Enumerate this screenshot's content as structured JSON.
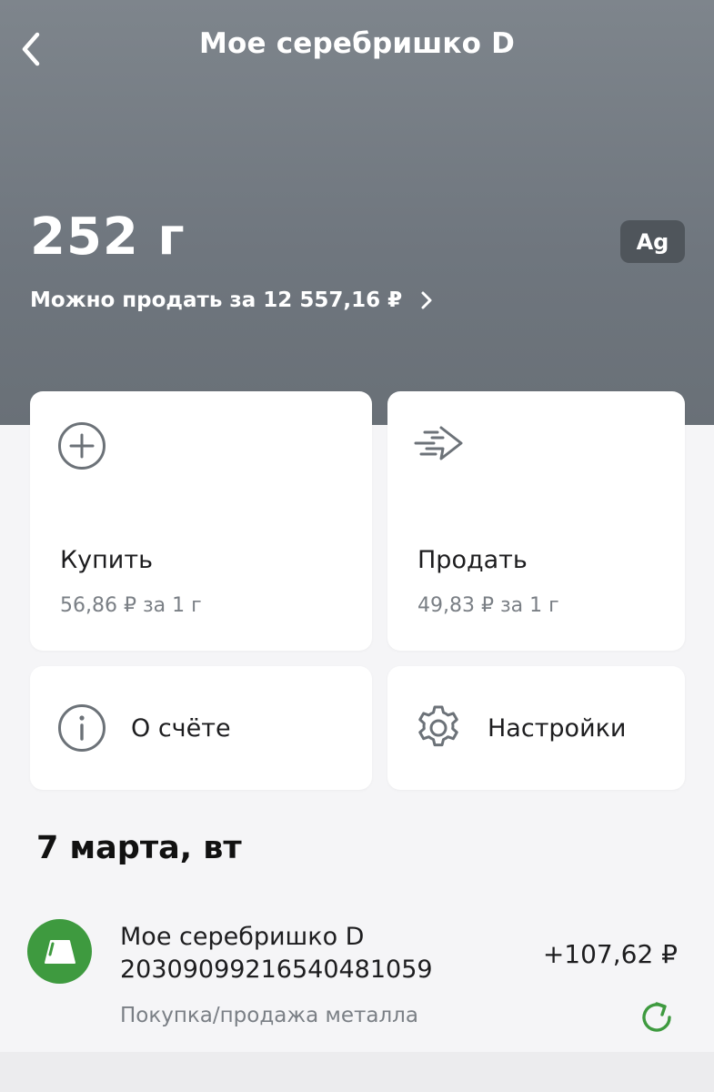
{
  "header": {
    "title": "Мое серебришко D",
    "back_icon": "chevron-left-icon"
  },
  "account": {
    "balance": "252 г",
    "metal_code": "Ag",
    "sell_for": "Можно продать за 12 557,16 ₽"
  },
  "actions": {
    "buy": {
      "label": "Купить",
      "price": "56,86 ₽ за 1 г",
      "icon": "plus-circle-icon"
    },
    "sell": {
      "label": "Продать",
      "price": "49,83 ₽ за 1 г",
      "icon": "arrow-right-icon"
    },
    "about": {
      "label": "О счёте",
      "icon": "info-icon"
    },
    "settings": {
      "label": "Настройки",
      "icon": "gear-icon"
    }
  },
  "history": {
    "date": "7 марта, вт",
    "transactions": [
      {
        "title": "Мое серебришко D 20309099216540481059",
        "subtitle": "Покупка/продажа металла",
        "amount": "+107,62 ₽"
      }
    ]
  },
  "colors": {
    "header_bg": "#737a81",
    "badge_bg": "#4f555b",
    "accent_green": "#3e9a3f",
    "icon_gray": "#6c7278"
  }
}
